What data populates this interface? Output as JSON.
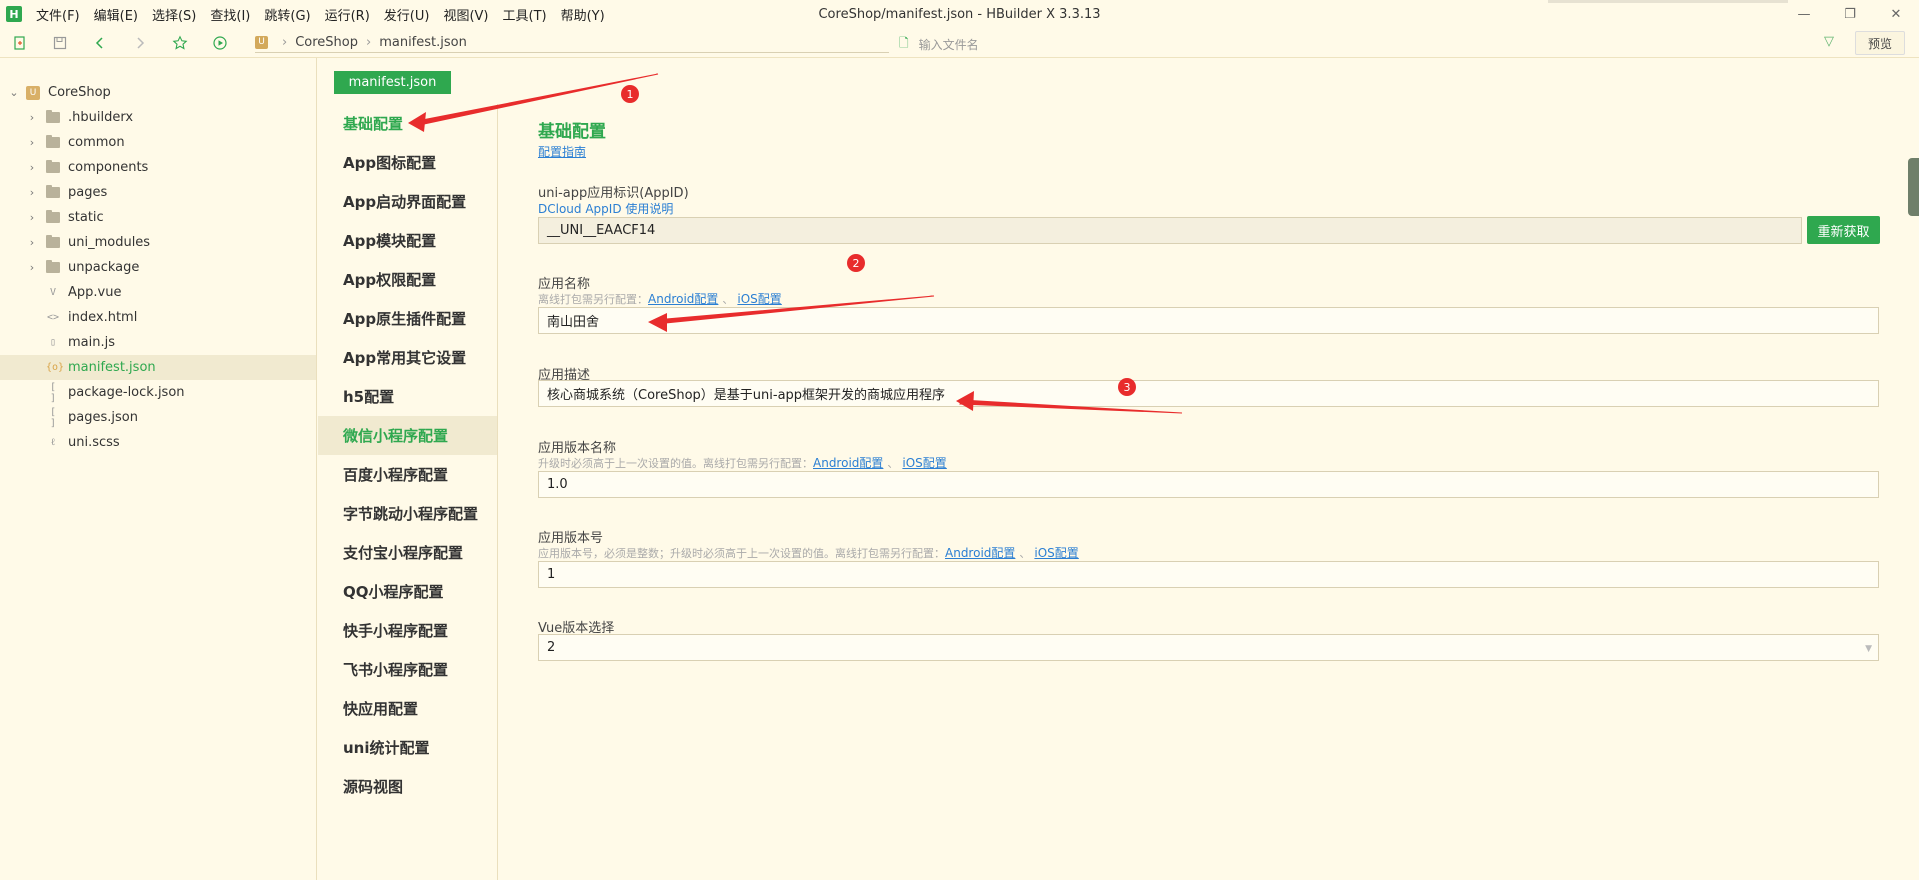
{
  "window": {
    "logo": "H",
    "title": "CoreShop/manifest.json - HBuilder X 3.3.13",
    "menu": [
      "文件(F)",
      "编辑(E)",
      "选择(S)",
      "查找(I)",
      "跳转(G)",
      "运行(R)",
      "发行(U)",
      "视图(V)",
      "工具(T)",
      "帮助(Y)"
    ]
  },
  "toolbar": {
    "breadcrumb": [
      "CoreShop",
      "manifest.json"
    ],
    "search_placeholder": "输入文件名",
    "preview_label": "预览"
  },
  "filetree": {
    "project": "CoreShop",
    "folders": [
      ".hbuilderx",
      "common",
      "components",
      "pages",
      "static",
      "uni_modules",
      "unpackage"
    ],
    "files": [
      {
        "name": "App.vue",
        "icon": "V"
      },
      {
        "name": "index.html",
        "icon": "<>"
      },
      {
        "name": "main.js",
        "icon": "▯"
      },
      {
        "name": "manifest.json",
        "icon": "{o}",
        "active": true
      },
      {
        "name": "package-lock.json",
        "icon": "[ ]"
      },
      {
        "name": "pages.json",
        "icon": "[ ]"
      },
      {
        "name": "uni.scss",
        "icon": "ℓ"
      }
    ]
  },
  "editor": {
    "tab_label": "manifest.json",
    "nav": [
      "基础配置",
      "App图标配置",
      "App启动界面配置",
      "App模块配置",
      "App权限配置",
      "App原生插件配置",
      "App常用其它设置",
      "h5配置",
      "微信小程序配置",
      "百度小程序配置",
      "字节跳动小程序配置",
      "支付宝小程序配置",
      "QQ小程序配置",
      "快手小程序配置",
      "飞书小程序配置",
      "快应用配置",
      "uni统计配置",
      "源码视图"
    ]
  },
  "form": {
    "section_title": "基础配置",
    "guide_link": "配置指南",
    "appid": {
      "label": "uni-app应用标识(AppID)",
      "link": "DCloud AppID 使用说明",
      "value": "__UNI__EAACF14",
      "refetch": "重新获取"
    },
    "name": {
      "label": "应用名称",
      "hint": "离线打包需另行配置：",
      "link_android": "Android配置",
      "link_ios": "iOS配置",
      "value": "南山田舍"
    },
    "description": {
      "label": "应用描述",
      "value": "核心商城系统（CoreShop）是基于uni-app框架开发的商城应用程序"
    },
    "version_name": {
      "label": "应用版本名称",
      "hint": "升级时必须高于上一次设置的值。离线打包需另行配置：",
      "link_android": "Android配置",
      "link_ios": "iOS配置",
      "value": "1.0"
    },
    "version_code": {
      "label": "应用版本号",
      "hint": "应用版本号，必须是整数；升级时必须高于上一次设置的值。离线打包需另行配置：",
      "link_android": "Android配置",
      "link_ios": "iOS配置",
      "value": "1"
    },
    "vue_version": {
      "label": "Vue版本选择",
      "value": "2"
    }
  },
  "annotations": {
    "badges": [
      "1",
      "2",
      "3"
    ],
    "color": "#e82c2c"
  },
  "colors": {
    "accent": "#2fa84f",
    "background": "#fffae8",
    "link": "#2b7fd3"
  }
}
